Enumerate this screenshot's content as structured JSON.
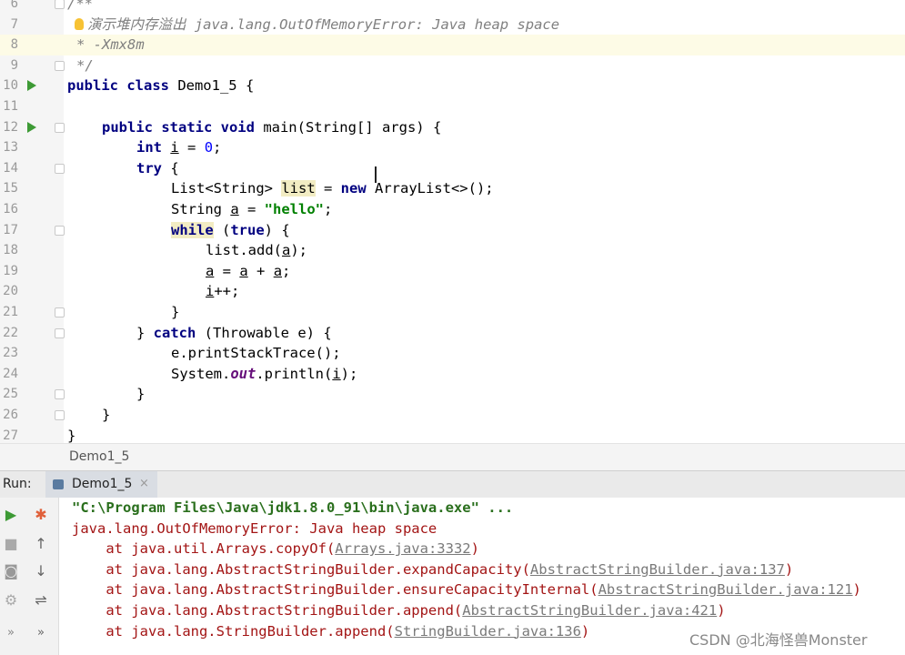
{
  "editor": {
    "lines": [
      {
        "n": "6"
      },
      {
        "n": "7"
      },
      {
        "n": "8"
      },
      {
        "n": "9"
      },
      {
        "n": "10"
      },
      {
        "n": "11"
      },
      {
        "n": "12"
      },
      {
        "n": "13"
      },
      {
        "n": "14"
      },
      {
        "n": "15"
      },
      {
        "n": "16"
      },
      {
        "n": "17"
      },
      {
        "n": "18"
      },
      {
        "n": "19"
      },
      {
        "n": "20"
      },
      {
        "n": "21"
      },
      {
        "n": "22"
      },
      {
        "n": "23"
      },
      {
        "n": "24"
      },
      {
        "n": "25"
      },
      {
        "n": "26"
      },
      {
        "n": "27"
      }
    ],
    "t": {
      "c6": "/**",
      "c7_star": "* ",
      "c7": "演示堆内存溢出 java.lang.OutOfMemoryError: Java heap space",
      "c8": "* -Xmx8m",
      "c9": "*/",
      "l10a": "public class",
      "l10b": " Demo1_5 {",
      "l12a": "public static void",
      "l12b": " main(String[] args) {",
      "l13a": "int",
      "l13b": " ",
      "l13c": "i",
      "l13d": " = ",
      "l13e": "0",
      "l13f": ";",
      "l14a": "try",
      "l14b": " {",
      "l15a": "List<String> ",
      "l15b": "list",
      "l15c": " = ",
      "l15d": "new",
      "l15e": " ArrayList<>();",
      "l16a": "String ",
      "l16b": "a",
      "l16c": " = ",
      "l16d": "\"hello\"",
      "l16e": ";",
      "l17a": "while",
      "l17b": " (",
      "l17c": "true",
      "l17d": ") {",
      "l18a": "list.add(",
      "l18b": "a",
      "l18c": ");",
      "l19a": "a",
      "l19b": " = ",
      "l19c": "a",
      "l19d": " + ",
      "l19e": "a",
      "l19f": ";",
      "l20a": "i",
      "l20b": "++;",
      "l21": "}",
      "l22a": "} ",
      "l22b": "catch",
      "l22c": " (Throwable e) {",
      "l23": "e.printStackTrace();",
      "l24a": "System.",
      "l24b": "out",
      "l24c": ".println(",
      "l24d": "i",
      "l24e": ");",
      "l25": "}",
      "l26": "}",
      "l27": "}"
    }
  },
  "breadcrumb": "Demo1_5",
  "run": {
    "label": "Run:",
    "tab": "Demo1_5",
    "tab_close": "×"
  },
  "console": {
    "cmd": "\"C:\\Program Files\\Java\\jdk1.8.0_91\\bin\\java.exe\" ...",
    "err": "java.lang.OutOfMemoryError: Java heap space",
    "frames": [
      {
        "pre": "    at java.util.Arrays.copyOf(",
        "link": "Arrays.java:3332",
        "post": ")"
      },
      {
        "pre": "    at java.lang.AbstractStringBuilder.expandCapacity(",
        "link": "AbstractStringBuilder.java:137",
        "post": ")"
      },
      {
        "pre": "    at java.lang.AbstractStringBuilder.ensureCapacityInternal(",
        "link": "AbstractStringBuilder.java:121",
        "post": ")"
      },
      {
        "pre": "    at java.lang.AbstractStringBuilder.append(",
        "link": "AbstractStringBuilder.java:421",
        "post": ")"
      },
      {
        "pre": "    at java.lang.StringBuilder.append(",
        "link": "StringBuilder.java:136",
        "post": ")"
      }
    ]
  },
  "watermark": "CSDN @北海怪兽Monster",
  "colors": {
    "keyword": "#000080",
    "string": "#008000",
    "number": "#0000ff",
    "comment": "#808080",
    "run_green": "#3d9a35"
  },
  "icons": [
    "run-icon",
    "stop-icon",
    "camera-icon",
    "settings-icon",
    "expand-icon",
    "debug-icon",
    "up-arrow-icon",
    "down-arrow-icon",
    "wrap-icon",
    "bulb-icon"
  ]
}
